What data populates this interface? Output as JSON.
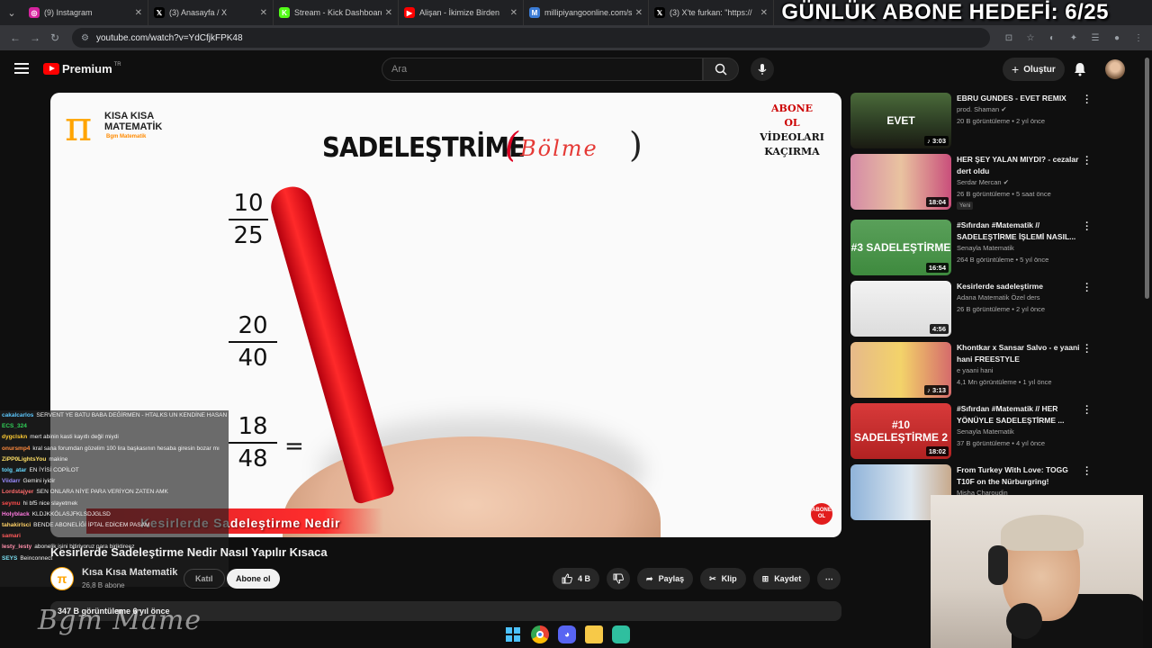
{
  "browser": {
    "tabs": [
      {
        "label": "(9) Instagram",
        "color": "#d6249f",
        "glyph": "◎"
      },
      {
        "label": "(3) Anasayfa / X",
        "color": "#000000",
        "glyph": "𝕏"
      },
      {
        "label": "Stream - Kick Dashboard",
        "color": "#53fc18",
        "glyph": "K"
      },
      {
        "label": "Alişan - İkimize Birden",
        "color": "#ff0000",
        "glyph": "▶"
      },
      {
        "label": "millipiyangoonline.com/s",
        "color": "#3a7bd5",
        "glyph": "M"
      },
      {
        "label": "(3) X'te furkan: \"https://",
        "color": "#000000",
        "glyph": "𝕏"
      }
    ],
    "url": "youtube.com/watch?v=YdCfjkFPK48"
  },
  "overlay": {
    "goal_text": "GÜNLÜK ABONE HEDEFİ: 6/25"
  },
  "youtube": {
    "logo_word": "Premium",
    "logo_region": "TR",
    "search_placeholder": "Ara",
    "create_label": "Oluştur"
  },
  "video": {
    "brand_line1": "KISA KISA",
    "brand_line2": "MATEMATİK",
    "brand_line3": "Bgm Matematik",
    "heading": "SADELEŞTRİME",
    "scribble": "Bölme",
    "cta_lines": [
      "ABONE",
      "OL",
      "VİDEOLARI",
      "KAÇIRMA"
    ],
    "fractions": [
      {
        "num": "10",
        "den": "25"
      },
      {
        "num": "20",
        "den": "40"
      },
      {
        "num": "18",
        "den": "48",
        "eq": "="
      }
    ],
    "banner": "Kesirlerde Sadeleştirme Nedir",
    "badge": "ABONE OL"
  },
  "chat": [
    {
      "user": "cakalcarlos",
      "color": "#5cc8ff",
      "msg": "SERVENT YE BATU BABA DEĞİRMEN - HTALKS UN KENDİNE HASAN HOCA Mİ BU"
    },
    {
      "user": "ECS_324",
      "color": "#31d158",
      "msg": ""
    },
    {
      "user": "dygclskn",
      "color": "#ffcc33",
      "msg": "mert abinin kasti kayıtlı değil miydi"
    },
    {
      "user": "onursmp4",
      "color": "#ff8a3d",
      "msg": "kral sana forumdan gözelim 100 lira başkasının hesaba giresin bozar mı"
    },
    {
      "user": "ZiPP0LightsYou",
      "color": "#ffe066",
      "msg": "makine"
    },
    {
      "user": "tolg_atar",
      "color": "#66d9ff",
      "msg": "EN İYİSİ COPİLOT"
    },
    {
      "user": "Viidarr",
      "color": "#9b8cff",
      "msg": "Gemini iyidir"
    },
    {
      "user": "Lordstajyer",
      "color": "#ff6b6b",
      "msg": "SEN ONLARA NİYE PARA VERİYON ZATEN AMK"
    },
    {
      "user": "seymu",
      "color": "#ff4d4d",
      "msg": "hi bf5 nice slayetmek"
    },
    {
      "user": "Holyblack",
      "color": "#ff7ae0",
      "msg": "KLDJKKÖLASJFKLSDJGLSD"
    },
    {
      "user": "tahakirlsci",
      "color": "#ffd166",
      "msg": "BENDE ABONELİĞİ İPTAL EDİCEM PASAM"
    },
    {
      "user": "samari",
      "color": "#ff5a5a",
      "msg": ""
    },
    {
      "user": "lesty_lesty",
      "color": "#ff8fab",
      "msg": "abonelik işini bitiriyoruz para biriktireez"
    },
    {
      "user": "SEYS",
      "color": "#7bdff2",
      "msg": "Beinconnect"
    }
  ],
  "below": {
    "title": "Kesirlerde Sadeleştirme Nedir Nasıl Yapılır Kısaca",
    "channel": "Kısa Kısa Matematik",
    "subs": "26,8 B abone",
    "join": "Katıl",
    "subscribe": "Abone ol",
    "likes": "4 B",
    "share": "Paylaş",
    "clip": "Klip",
    "save": "Kaydet",
    "views": "347 B görüntüleme  6 yıl önce",
    "watermark": "Bgm Mame"
  },
  "sidebar": [
    {
      "title": "EBRU GUNDES - EVET REMIX",
      "channel": "prod. Shaman",
      "verified": true,
      "meta": "20 B görüntüleme • 2 yıl önce",
      "duration": "3:03",
      "music": true,
      "bg": "linear-gradient(180deg,#4a6a3a,#2b3a22 60%,#1a1a12)",
      "thumbtext": "EVET"
    },
    {
      "title": "HER ŞEY YALAN MIYDI? - cezalar dert oldu",
      "channel": "Serdar Mercan",
      "verified": true,
      "meta": "26 B görüntüleme • 5 saat önce",
      "new": "Yeni",
      "duration": "18:04",
      "bg": "linear-gradient(90deg,#d58aa6,#e9c3a0 50%,#c94f7b)",
      "thumbtext": ""
    },
    {
      "title": "#Sıfırdan #Matematik // SADELEŞTİRME İŞLEMİ NASIL...",
      "channel": "Senayla Matematik",
      "meta": "264 B görüntüleme • 5 yıl önce",
      "duration": "16:54",
      "bg": "linear-gradient(180deg,#5aa05a,#3e8a3e)",
      "thumbtext": "#3 SADELEŞTİRME"
    },
    {
      "title": "Kesirlerde sadeleştirme",
      "channel": "Adana Matematik Özel ders",
      "meta": "26 B görüntüleme • 2 yıl önce",
      "duration": "4:56",
      "bg": "linear-gradient(180deg,#f2f2f2,#dcdcdc)",
      "thumbtext": ""
    },
    {
      "title": "Khontkar x Sansar Salvo - e yaani hani FREESTYLE",
      "channel": "e yaani hani",
      "meta": "4,1 Mn görüntüleme • 1 yıl önce",
      "duration": "3:13",
      "music": true,
      "bg": "linear-gradient(90deg,#e6b98a,#f3d36a 50%,#d56b6b)",
      "thumbtext": ""
    },
    {
      "title": "#Sıfırdan #Matematik // HER YÖNÜYLE SADELEŞTİRME ...",
      "channel": "Senayla Matematik",
      "meta": "37 B görüntüleme • 4 yıl önce",
      "duration": "18:02",
      "bg": "linear-gradient(180deg,#d83a3a,#b22222)",
      "thumbtext": "#10 SADELEŞTİRME 2"
    },
    {
      "title": "From Turkey With Love: TOGG T10F on the Nürburgring!",
      "channel": "Misha Charoudin",
      "meta": "",
      "duration": "",
      "bg": "linear-gradient(90deg,#8fb3d9,#dfe8f0 60%,#c7a98c)",
      "thumbtext": ""
    }
  ]
}
